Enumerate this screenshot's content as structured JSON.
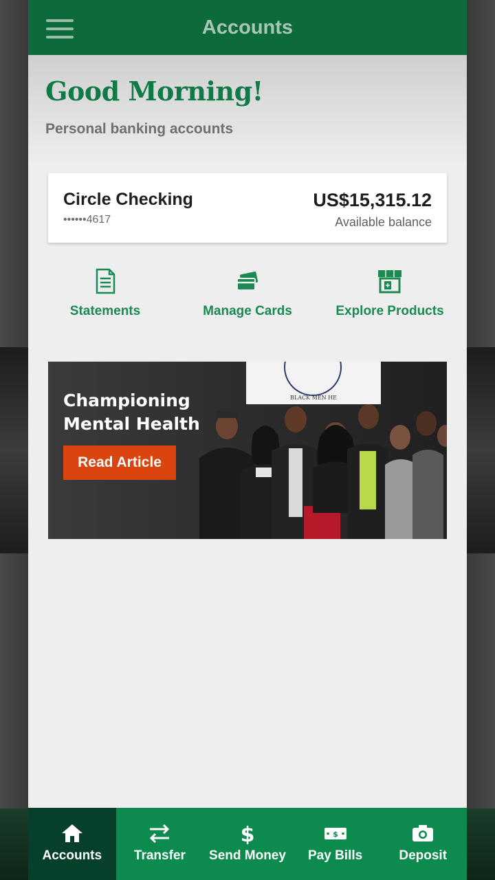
{
  "header": {
    "title": "Accounts"
  },
  "greeting": {
    "title": "Good Morning!",
    "subtitle": "Personal banking accounts"
  },
  "account": {
    "name": "Circle Checking",
    "number_masked": "••••••4617",
    "balance": "US$15,315.12",
    "balance_label": "Available balance"
  },
  "quick_actions": [
    {
      "label": "Statements",
      "icon": "document-icon"
    },
    {
      "label": "Manage Cards",
      "icon": "cards-icon"
    },
    {
      "label": "Explore Products",
      "icon": "storefront-icon"
    }
  ],
  "banner": {
    "title": "Championing Mental Health",
    "button_label": "Read Article",
    "sign_text": "BLACK MEN HE"
  },
  "bottom_nav": [
    {
      "label": "Accounts",
      "icon": "home-icon",
      "active": true
    },
    {
      "label": "Transfer",
      "icon": "transfer-arrows-icon",
      "active": false
    },
    {
      "label": "Send Money",
      "icon": "dollar-icon",
      "active": false
    },
    {
      "label": "Pay Bills",
      "icon": "bill-icon",
      "active": false
    },
    {
      "label": "Deposit",
      "icon": "camera-icon",
      "active": false
    }
  ],
  "colors": {
    "brand_green": "#0d6b3b",
    "nav_green": "#0d8a4e",
    "nav_active": "#07402a",
    "accent_text_green": "#1a8a52",
    "cta_orange": "#d9440f"
  }
}
